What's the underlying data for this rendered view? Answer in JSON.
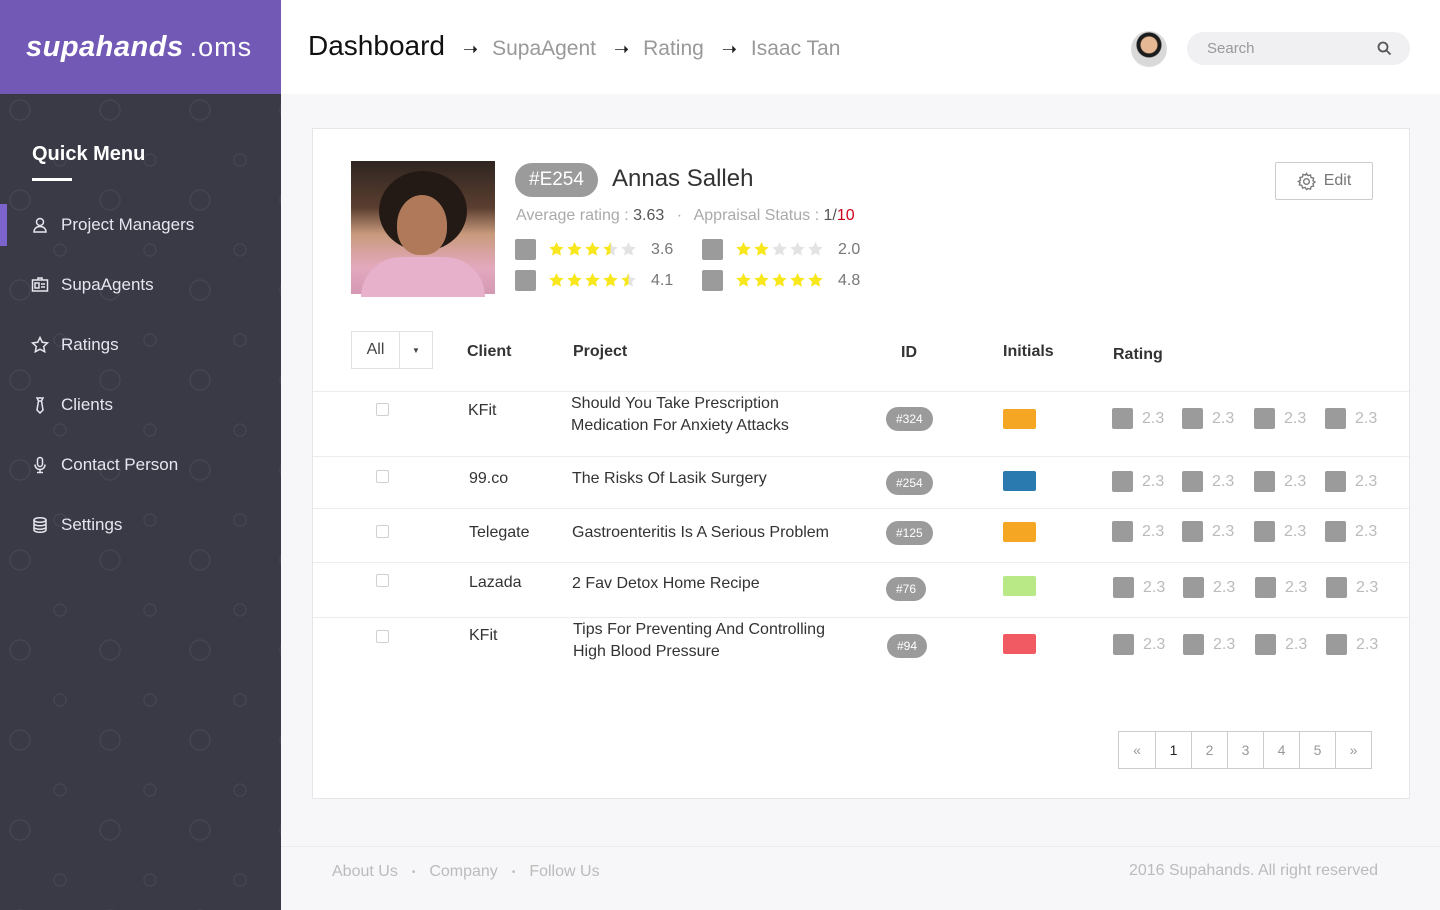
{
  "app": {
    "brand": "supahands",
    "brand_suffix": ".oms"
  },
  "sidebar": {
    "title": "Quick Menu",
    "items": [
      {
        "label": "Project Managers",
        "icon": "user-icon",
        "active": true
      },
      {
        "label": "SupaAgents",
        "icon": "id-card-icon",
        "active": false
      },
      {
        "label": "Ratings",
        "icon": "star-icon",
        "active": false
      },
      {
        "label": "Clients",
        "icon": "tie-icon",
        "active": false
      },
      {
        "label": "Contact Person",
        "icon": "microphone-icon",
        "active": false
      },
      {
        "label": "Settings",
        "icon": "database-icon",
        "active": false
      }
    ]
  },
  "header": {
    "breadcrumb": [
      "Dashboard",
      "SupaAgent",
      "Rating",
      "Isaac Tan"
    ],
    "search_placeholder": "Search"
  },
  "profile": {
    "id_badge": "#E254",
    "name": "Annas Salleh",
    "avg_label": "Average rating :",
    "avg_value": "3.63",
    "appraisal_label": "Appraisal Status :",
    "appraisal_num": "1/",
    "appraisal_den": "10",
    "edit_label": "Edit",
    "ratings": [
      {
        "value": "3.6",
        "stars": 3.5
      },
      {
        "value": "2.0",
        "stars": 2
      },
      {
        "value": "4.1",
        "stars": 4.5
      },
      {
        "value": "4.8",
        "stars": 5
      }
    ]
  },
  "table": {
    "filter_value": "All",
    "columns": [
      "Client",
      "Project",
      "ID",
      "Initials",
      "Rating"
    ],
    "rows": [
      {
        "client": "KFit",
        "project_line1": "Should You Take Prescription",
        "project_line2": "Medication For Anxiety Attacks",
        "id": "#324",
        "color": "#f5a623",
        "ratings": [
          "2.3",
          "2.3",
          "2.3",
          "2.3"
        ]
      },
      {
        "client": "99.co",
        "project_line1": "The Risks Of Lasik Surgery",
        "project_line2": "",
        "id": "#254",
        "color": "#2a7ab0",
        "ratings": [
          "2.3",
          "2.3",
          "2.3",
          "2.3"
        ]
      },
      {
        "client": "Telegate",
        "project_line1": "Gastroenteritis Is A Serious Problem",
        "project_line2": "",
        "id": "#125",
        "color": "#f5a623",
        "ratings": [
          "2.3",
          "2.3",
          "2.3",
          "2.3"
        ]
      },
      {
        "client": "Lazada",
        "project_line1": "2 Fav Detox Home Recipe",
        "project_line2": "",
        "id": "#76",
        "color": "#b8e986",
        "ratings": [
          "2.3",
          "2.3",
          "2.3",
          "2.3"
        ]
      },
      {
        "client": "KFit",
        "project_line1": "Tips For Preventing And Controlling",
        "project_line2": "High Blood Pressure",
        "id": "#94",
        "color": "#f25a63",
        "ratings": [
          "2.3",
          "2.3",
          "2.3",
          "2.3"
        ]
      }
    ]
  },
  "pagination": {
    "prev": "«",
    "pages": [
      "1",
      "2",
      "3",
      "4",
      "5"
    ],
    "next": "»",
    "current": "1"
  },
  "footer": {
    "links": [
      "About Us",
      "Company",
      "Follow Us"
    ],
    "separator": "•",
    "copyright": "2016 Supahands. All right reserved"
  },
  "colors": {
    "brand": "#7259b5",
    "sidebar_bg": "#3a3a47",
    "star": "#f8e71c",
    "appraisal_total": "#d0021b"
  }
}
